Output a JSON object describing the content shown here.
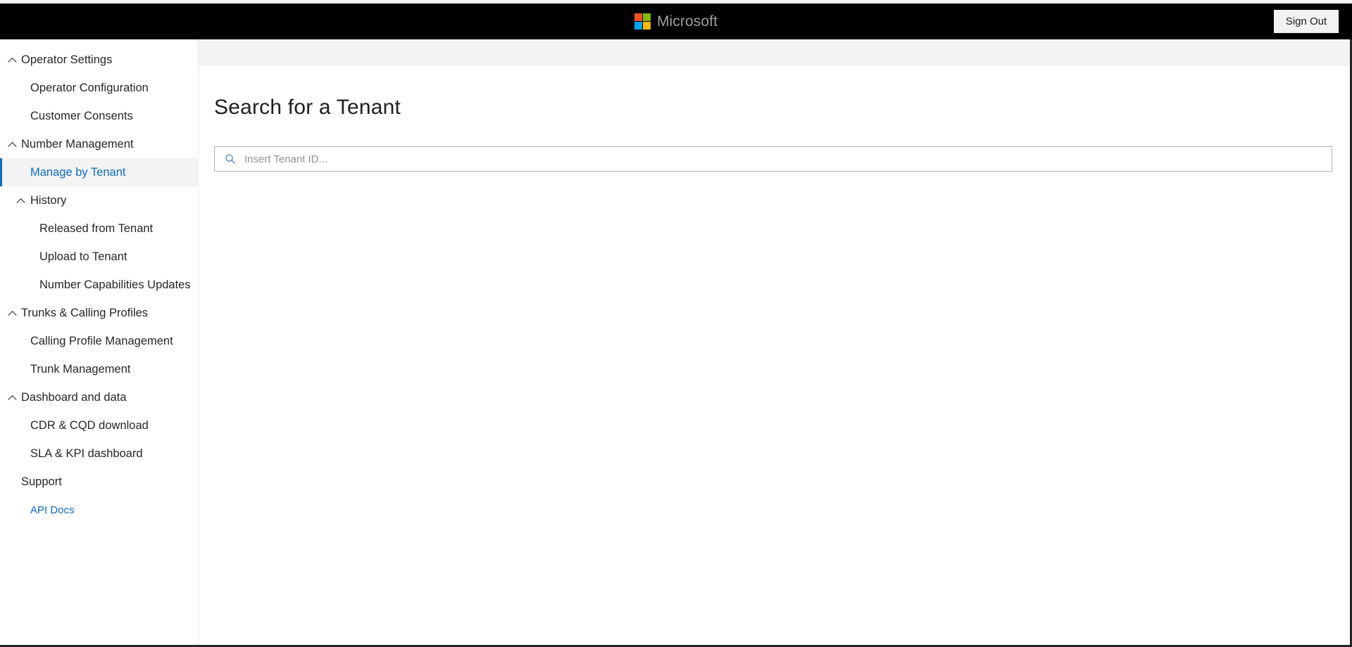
{
  "header": {
    "brand_name": "Microsoft",
    "logo_icon": "microsoft-logo-icon",
    "sign_out_label": "Sign Out",
    "background_color": "#000000",
    "brand_text_color": "#9e9e9e",
    "logo_colors": {
      "red": "#f25022",
      "green": "#7fba00",
      "blue": "#00a4ef",
      "yellow": "#ffb900"
    }
  },
  "sidebar": {
    "accent_color": "#0f6cbd",
    "selected_background": "#f3f3f3",
    "items": [
      {
        "label": "Operator Settings",
        "level": "group",
        "chevron": "chevron-up-icon",
        "selected": false,
        "link": false
      },
      {
        "label": "Operator Configuration",
        "level": "1",
        "chevron": null,
        "selected": false,
        "link": false
      },
      {
        "label": "Customer Consents",
        "level": "1",
        "chevron": null,
        "selected": false,
        "link": false
      },
      {
        "label": "Number Management",
        "level": "group",
        "chevron": "chevron-up-icon",
        "selected": false,
        "link": false
      },
      {
        "label": "Manage by Tenant",
        "level": "1",
        "chevron": null,
        "selected": true,
        "link": false
      },
      {
        "label": "History",
        "level": "group-2",
        "chevron": "chevron-up-icon",
        "selected": false,
        "link": false
      },
      {
        "label": "Released from Tenant",
        "level": "2",
        "chevron": null,
        "selected": false,
        "link": false
      },
      {
        "label": "Upload to Tenant",
        "level": "2",
        "chevron": null,
        "selected": false,
        "link": false
      },
      {
        "label": "Number Capabilities Updates",
        "level": "2",
        "chevron": null,
        "selected": false,
        "link": false
      },
      {
        "label": "Trunks & Calling Profiles",
        "level": "group",
        "chevron": "chevron-up-icon",
        "selected": false,
        "link": false
      },
      {
        "label": "Calling Profile Management",
        "level": "1",
        "chevron": null,
        "selected": false,
        "link": false
      },
      {
        "label": "Trunk Management",
        "level": "1",
        "chevron": null,
        "selected": false,
        "link": false
      },
      {
        "label": "Dashboard and data",
        "level": "group",
        "chevron": "chevron-up-icon",
        "selected": false,
        "link": false
      },
      {
        "label": "CDR & CQD download",
        "level": "1",
        "chevron": null,
        "selected": false,
        "link": false
      },
      {
        "label": "SLA & KPI dashboard",
        "level": "1",
        "chevron": null,
        "selected": false,
        "link": false
      },
      {
        "label": "Support",
        "level": "group",
        "chevron": null,
        "selected": false,
        "link": false
      },
      {
        "label": "API Docs",
        "level": "1",
        "chevron": null,
        "selected": false,
        "link": true
      }
    ]
  },
  "main": {
    "page_title": "Search for a Tenant",
    "search": {
      "icon": "search-icon",
      "placeholder": "Insert Tenant ID...",
      "value": ""
    }
  }
}
